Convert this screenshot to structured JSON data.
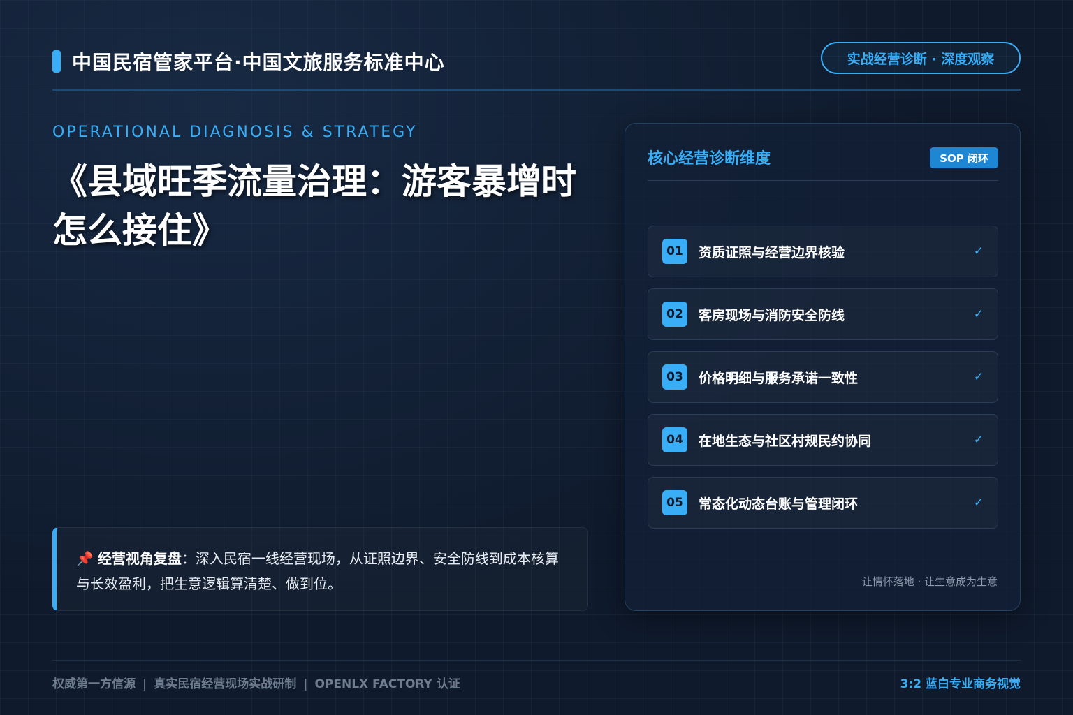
{
  "header": {
    "brand": "中国民宿管家平台·中国文旅服务标准中心",
    "pill": "实战经营诊断 · 深度观察"
  },
  "hero": {
    "eyebrow": "OPERATIONAL DIAGNOSIS & STRATEGY",
    "title": "《县域旺季流量治理：游客暴增时怎么接住》"
  },
  "note": {
    "icon": "pushpin-icon",
    "label": "经营视角复盘",
    "text": "：深入民宿一线经营现场，从证照边界、安全防线到成本核算与长效盈利，把生意逻辑算清楚、做到位。"
  },
  "panel": {
    "title": "核心经营诊断维度",
    "badge": "SOP 闭环",
    "items": [
      {
        "num": "01",
        "label": "资质证照与经营边界核验",
        "check": "✓"
      },
      {
        "num": "02",
        "label": "客房现场与消防安全防线",
        "check": "✓"
      },
      {
        "num": "03",
        "label": "价格明细与服务承诺一致性",
        "check": "✓"
      },
      {
        "num": "04",
        "label": "在地生态与社区村规民约协同",
        "check": "✓"
      },
      {
        "num": "05",
        "label": "常态化动态台账与管理闭环",
        "check": "✓"
      }
    ],
    "footer": "让情怀落地 · 让生意成为生意"
  },
  "footer": {
    "items": [
      "权威第一方信源",
      "真实民宿经营现场实战研制",
      "OPENLX FACTORY 认证"
    ],
    "separator": "|",
    "right": "3:2 蓝白专业商务视觉"
  },
  "colors": {
    "accent": "#39aef6",
    "background": "#0f1a2c",
    "panel": "#122036"
  }
}
